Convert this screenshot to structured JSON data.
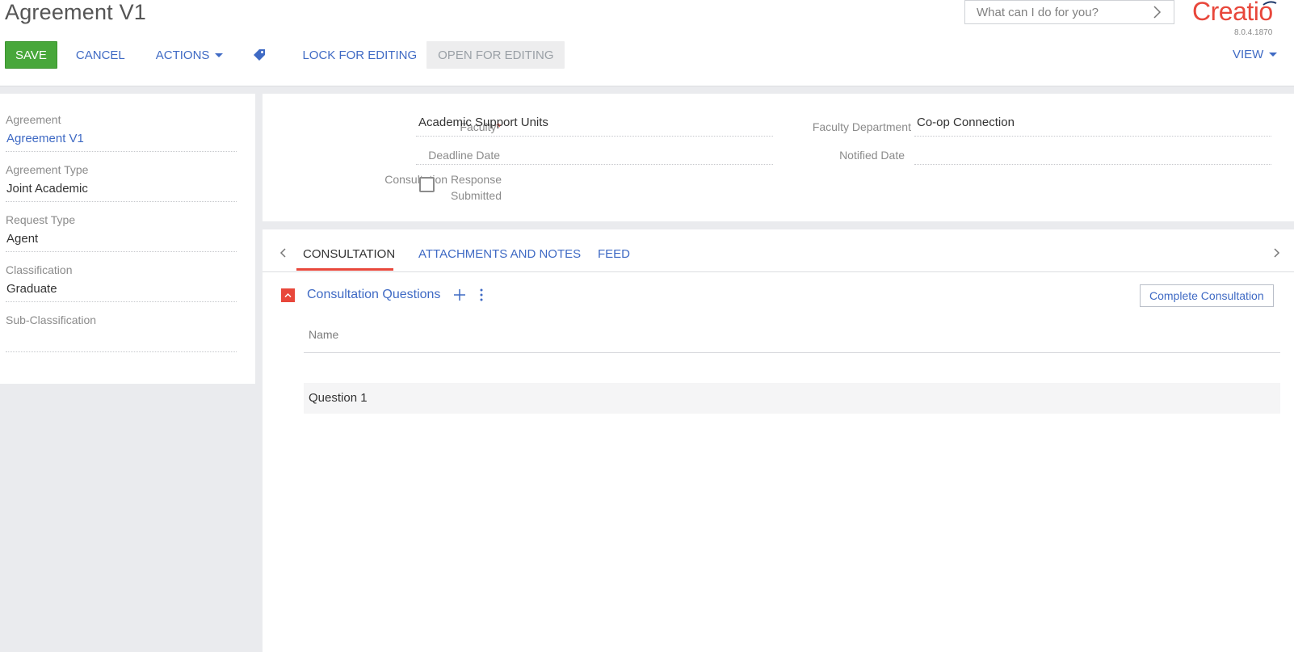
{
  "header": {
    "title": "Agreement V1",
    "search_placeholder": "What can I do for you?",
    "logo_text": "Creatio",
    "version": "8.0.4.1870"
  },
  "toolbar": {
    "save_label": "SAVE",
    "cancel_label": "CANCEL",
    "actions_label": "ACTIONS",
    "lock_label": "LOCK FOR EDITING",
    "open_label": "OPEN FOR EDITING",
    "view_label": "VIEW",
    "tag_icon": "tag-icon"
  },
  "left_fields": [
    {
      "label": "Agreement",
      "value": "Agreement V1"
    },
    {
      "label": "Agreement Type",
      "value": "Joint Academic"
    },
    {
      "label": "Request Type",
      "value": "Agent"
    },
    {
      "label": "Classification",
      "value": "Graduate"
    },
    {
      "label": "Sub-Classification",
      "value": ""
    }
  ],
  "top_fields": {
    "faculty_label": "Faculty",
    "faculty_value": "Academic Support Units",
    "faculty_department_label": "Faculty Department",
    "faculty_department_value": "Co-op Connection",
    "deadline_label": "Deadline Date",
    "deadline_value": "",
    "notified_label": "Notified Date",
    "notified_value": "",
    "consultation_response_label_1": "Consultation Response",
    "consultation_response_label_2": "Submitted",
    "consultation_response_checked": false
  },
  "tabs": [
    {
      "label": "CONSULTATION",
      "active": true
    },
    {
      "label": "ATTACHMENTS AND NOTES",
      "active": false
    },
    {
      "label": "FEED",
      "active": false
    }
  ],
  "consultation": {
    "section_title": "Consultation Questions",
    "complete_label": "Complete Consultation",
    "column_name": "Name",
    "rows": [
      "Question 1"
    ]
  },
  "colors": {
    "accent": "#e8473b",
    "link": "#3f6ac4",
    "save": "#48a73b"
  }
}
